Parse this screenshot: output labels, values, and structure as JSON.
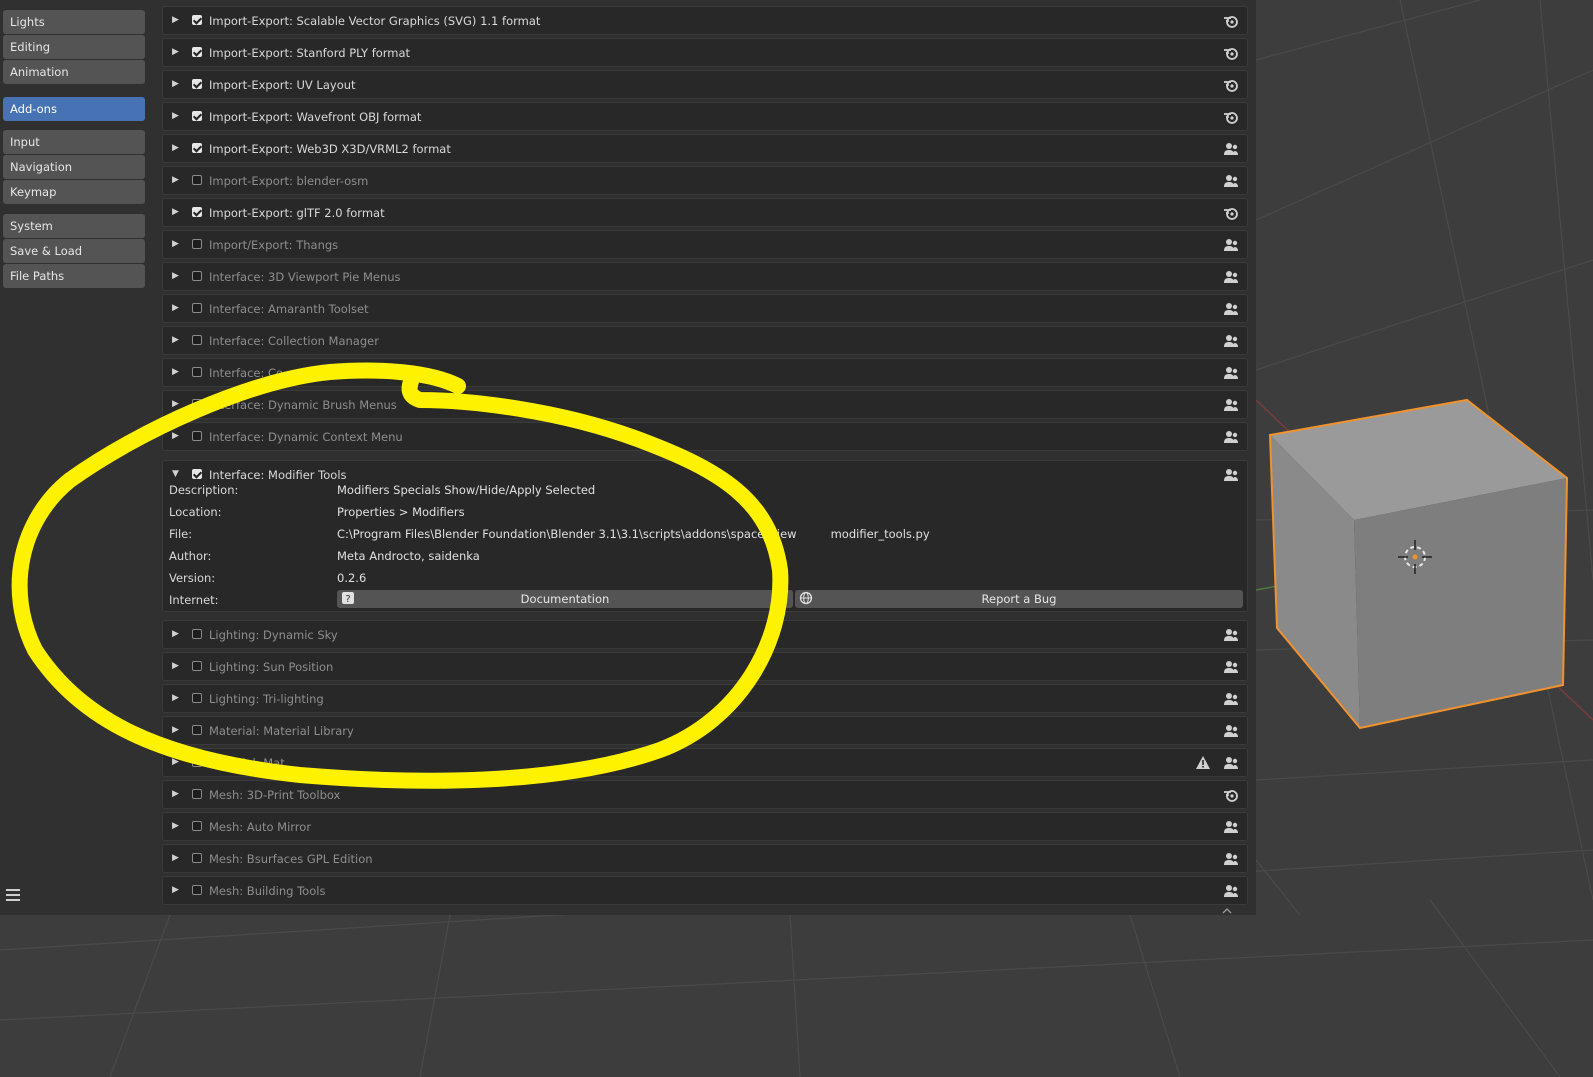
{
  "sidebar": {
    "group1": [
      {
        "label": "Lights"
      },
      {
        "label": "Editing"
      },
      {
        "label": "Animation"
      }
    ],
    "group2": [
      {
        "label": "Add-ons",
        "active": true
      }
    ],
    "group3": [
      {
        "label": "Input"
      },
      {
        "label": "Navigation"
      },
      {
        "label": "Keymap"
      }
    ],
    "group4": [
      {
        "label": "System"
      },
      {
        "label": "Save & Load"
      },
      {
        "label": "File Paths"
      }
    ]
  },
  "addons_before": [
    {
      "name": "Import-Export: Scalable Vector Graphics (SVG) 1.1 format",
      "enabled": true,
      "source": "official"
    },
    {
      "name": "Import-Export: Stanford PLY format",
      "enabled": true,
      "source": "official"
    },
    {
      "name": "Import-Export: UV Layout",
      "enabled": true,
      "source": "official"
    },
    {
      "name": "Import-Export: Wavefront OBJ format",
      "enabled": true,
      "source": "official"
    },
    {
      "name": "Import-Export: Web3D X3D/VRML2 format",
      "enabled": true,
      "source": "community"
    },
    {
      "name": "Import-Export: blender-osm",
      "enabled": false,
      "source": "community"
    },
    {
      "name": "Import-Export: glTF 2.0 format",
      "enabled": true,
      "source": "official"
    },
    {
      "name": "Import/Export: Thangs",
      "enabled": false,
      "source": "community"
    },
    {
      "name": "Interface: 3D Viewport Pie Menus",
      "enabled": false,
      "source": "community"
    },
    {
      "name": "Interface: Amaranth Toolset",
      "enabled": false,
      "source": "community"
    },
    {
      "name": "Interface: Collection Manager",
      "enabled": false,
      "source": "community"
    },
    {
      "name": "Interface: Co",
      "enabled": false,
      "source": "community"
    },
    {
      "name": "Interface: Dynamic Brush Menus",
      "enabled": false,
      "source": "community"
    },
    {
      "name": "Interface: Dynamic Context Menu",
      "enabled": false,
      "source": "community"
    }
  ],
  "expanded": {
    "name": "Interface: Modifier Tools",
    "enabled": true,
    "labels": {
      "description": "Description:",
      "location": "Location:",
      "file": "File:",
      "author": "Author:",
      "version": "Version:",
      "internet": "Internet:"
    },
    "description": "Modifiers Specials Show/Hide/Apply Selected",
    "location": "Properties > Modifiers",
    "file": "C:\\Program Files\\Blender Foundation\\Blender 3.1\\3.1\\scripts\\addons\\space_view",
    "file_tail": "modifier_tools.py",
    "author": "Meta Androcto, saidenka",
    "version": "0.2.6",
    "documentation_label": "Documentation",
    "report_bug_label": "Report a Bug"
  },
  "addons_after": [
    {
      "name": "Lighting: Dynamic Sky",
      "enabled": false,
      "source": "community"
    },
    {
      "name": "Lighting: Sun Position",
      "enabled": false,
      "source": "community"
    },
    {
      "name": "Lighting: Tri-lighting",
      "enabled": false,
      "source": "community"
    },
    {
      "name": "Material: Material Library",
      "enabled": false,
      "source": "community"
    },
    {
      "name": "Material: Mat",
      "enabled": false,
      "source": "community",
      "warning": true
    },
    {
      "name": "Mesh: 3D-Print Toolbox",
      "enabled": false,
      "source": "official"
    },
    {
      "name": "Mesh: Auto Mirror",
      "enabled": false,
      "source": "community"
    },
    {
      "name": "Mesh: Bsurfaces GPL Edition",
      "enabled": false,
      "source": "community"
    },
    {
      "name": "Mesh: Building Tools",
      "enabled": false,
      "source": "community"
    }
  ],
  "colors": {
    "accent": "#4772b3",
    "annotation": "#fff200",
    "selection_outline": "#f0922e"
  }
}
